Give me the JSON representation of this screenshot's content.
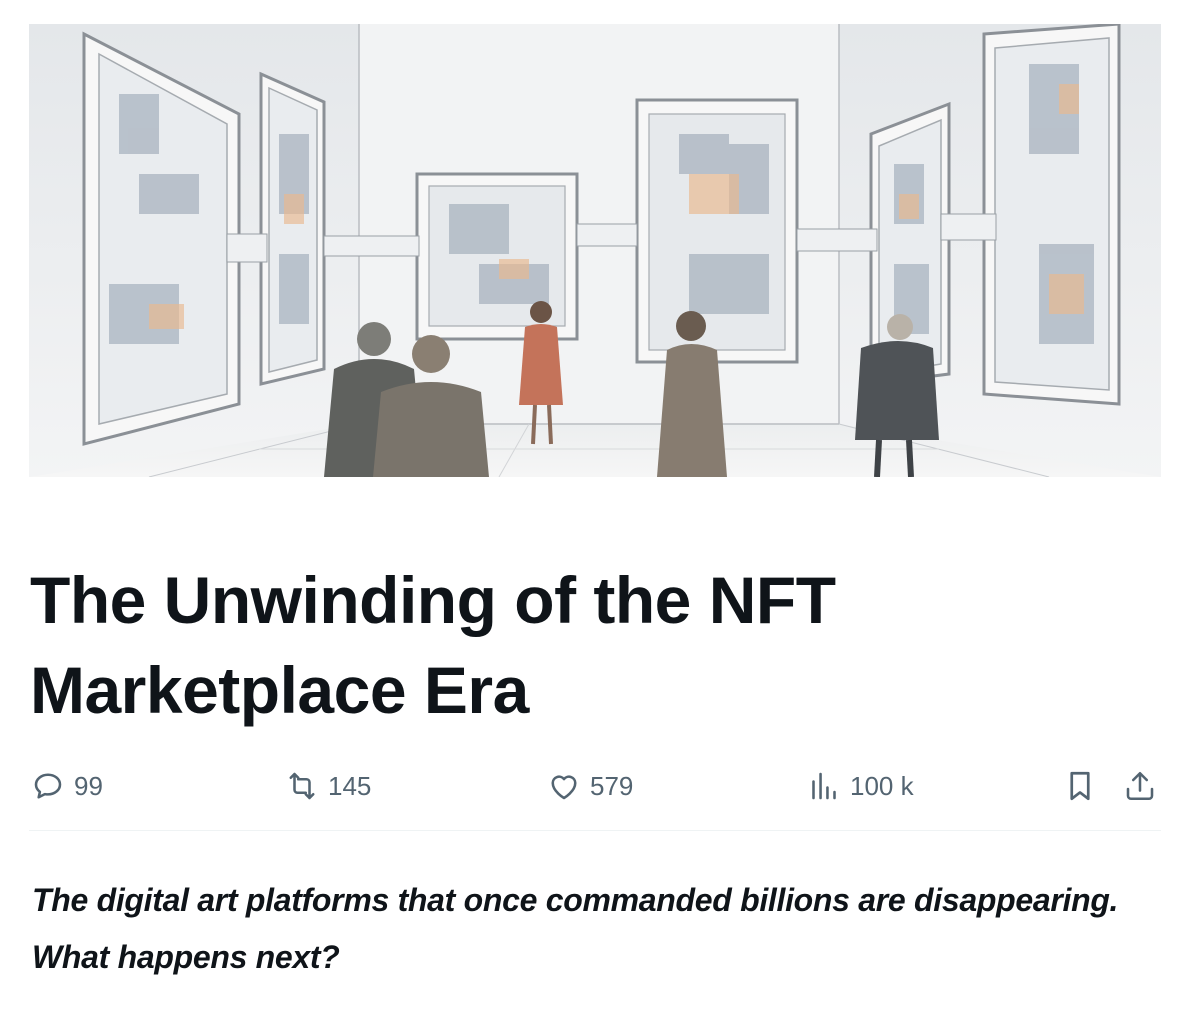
{
  "article": {
    "hero_image": "illustration: people viewing large framed pixel-art maps in a gallery",
    "title": "The Unwinding of the NFT Marketplace Era",
    "subtitle": "The digital art platforms that once commanded billions are disappearing. What happens next?"
  },
  "actions": {
    "replies": "99",
    "reposts": "145",
    "likes": "579",
    "views": "100 k",
    "icons": {
      "reply": "reply-bubble-icon",
      "repost": "repost-icon",
      "like": "heart-icon",
      "views": "analytics-bars-icon",
      "bookmark": "bookmark-icon",
      "share": "share-upload-icon"
    }
  },
  "colors": {
    "text": "#0f1419",
    "muted": "#536471",
    "divider": "#eff3f4"
  }
}
